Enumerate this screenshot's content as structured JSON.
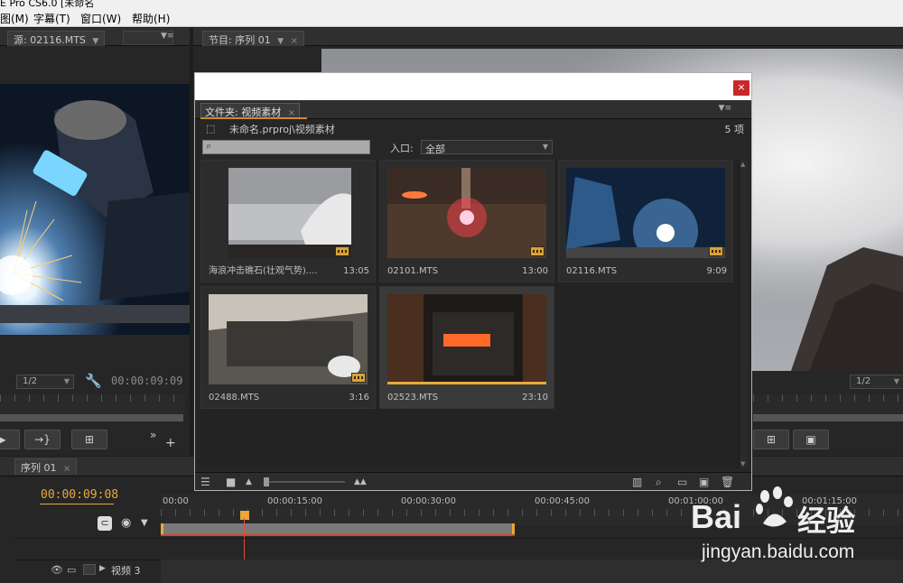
{
  "window": {
    "title": "E Pro CS6.0 [未命名"
  },
  "menubar": {
    "items": [
      "图(M)",
      "字幕(T)",
      "窗口(W)",
      "帮助(H)"
    ]
  },
  "source_panel": {
    "tab_prefix": "源:",
    "tab_label": "02116.MTS",
    "resolution": "1/2",
    "timecode": "00:00:09:09"
  },
  "program_panel": {
    "tab_label": "节目: 序列 01",
    "resolution": "1/2"
  },
  "bin": {
    "tab_label": "文件夹: 视频素材",
    "path": "未命名.prproj\\视频素材",
    "item_count": "5 项",
    "search_placeholder": "",
    "entry_label": "入口:",
    "entry_value": "全部",
    "items": [
      {
        "name": "海浪冲击礁石(壮观气势)....",
        "duration": "13:05"
      },
      {
        "name": "02101.MTS",
        "duration": "13:00"
      },
      {
        "name": "02116.MTS",
        "duration": "9:09"
      },
      {
        "name": "02488.MTS",
        "duration": "3:16"
      },
      {
        "name": "02523.MTS",
        "duration": "23:10"
      }
    ]
  },
  "timeline": {
    "tab_label": "序列 01",
    "timecode": "00:00:09:08",
    "ruler_labels": [
      "00:00",
      "00:00:15:00",
      "00:00:30:00",
      "00:00:45:00",
      "00:01:00:00",
      "00:01:15:00"
    ],
    "track_label": "视频 3",
    "accent": "#e8a93a"
  },
  "watermark": {
    "brand": "Bai",
    "brand_suffix": "经验",
    "url": "jingyan.baidu.com"
  }
}
